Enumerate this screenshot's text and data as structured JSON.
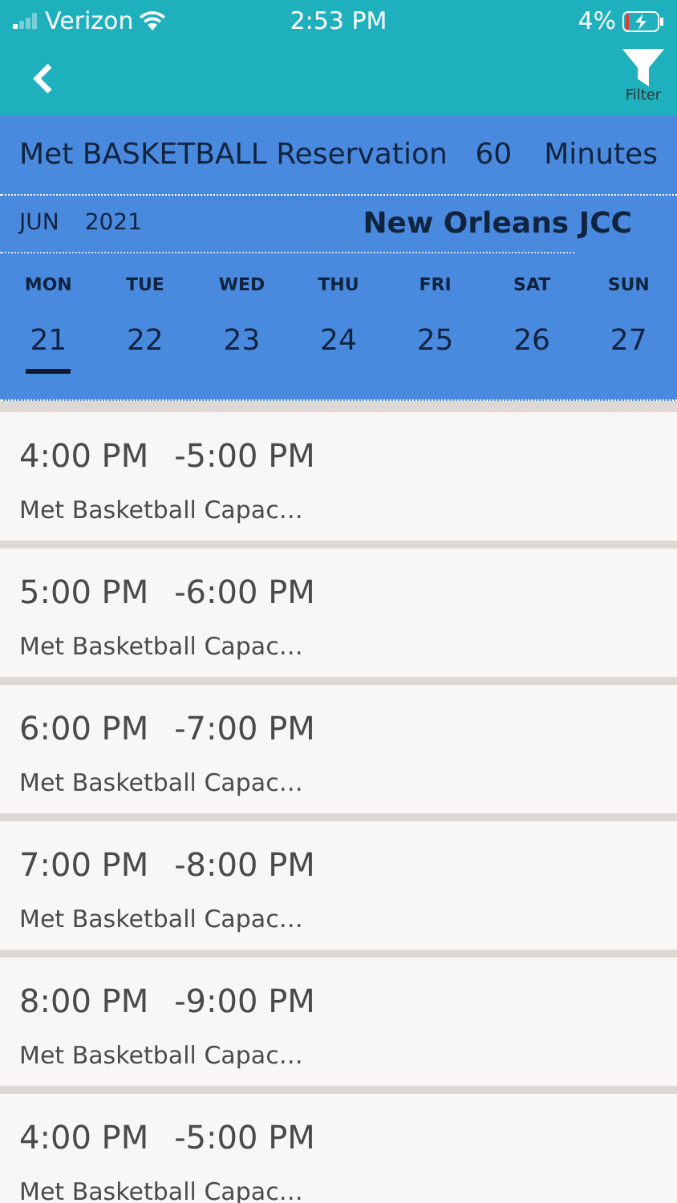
{
  "status_bar": {
    "carrier": "Verizon",
    "time": "2:53 PM",
    "battery": "4%"
  },
  "nav": {
    "filter_label": "Filter"
  },
  "header": {
    "title": "Met BASKETBALL Reservation",
    "duration": "60",
    "unit": "Minutes",
    "month": "JUN",
    "year": "2021",
    "location": "New Orleans JCC"
  },
  "days": [
    {
      "weekday": "MON",
      "date": "21",
      "selected": true
    },
    {
      "weekday": "TUE",
      "date": "22",
      "selected": false
    },
    {
      "weekday": "WED",
      "date": "23",
      "selected": false
    },
    {
      "weekday": "THU",
      "date": "24",
      "selected": false
    },
    {
      "weekday": "FRI",
      "date": "25",
      "selected": false
    },
    {
      "weekday": "SAT",
      "date": "26",
      "selected": false
    },
    {
      "weekday": "SUN",
      "date": "27",
      "selected": false
    }
  ],
  "slots": [
    {
      "start": "4:00 PM",
      "end": "-5:00 PM",
      "name": "Met Basketball Capac…"
    },
    {
      "start": "5:00 PM",
      "end": "-6:00 PM",
      "name": "Met Basketball Capac…"
    },
    {
      "start": "6:00 PM",
      "end": "-7:00 PM",
      "name": "Met Basketball Capac…"
    },
    {
      "start": "7:00 PM",
      "end": "-8:00 PM",
      "name": "Met Basketball Capac…"
    },
    {
      "start": "8:00 PM",
      "end": "-9:00 PM",
      "name": "Met Basketball Capac…"
    },
    {
      "start": "4:00 PM",
      "end": "-5:00 PM",
      "name": "Met Basketball Capac…"
    }
  ]
}
